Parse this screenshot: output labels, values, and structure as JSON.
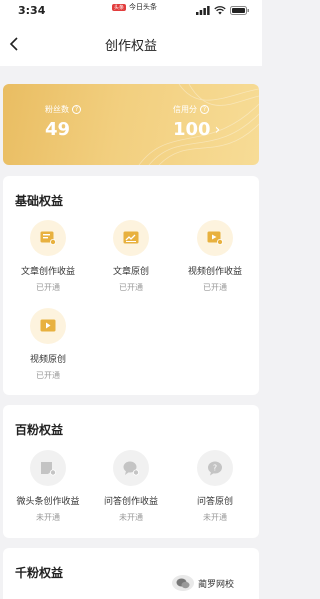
{
  "status_bar": {
    "time": "3:34",
    "app_badge": "头条",
    "app_name": "今日头条"
  },
  "nav": {
    "title": "创作权益",
    "back_icon": "chevron-left-icon"
  },
  "summary": {
    "fans_label": "粉丝数",
    "fans_value": "49",
    "credit_label": "信用分",
    "credit_value": "100"
  },
  "sections": [
    {
      "title": "基础权益",
      "items": [
        {
          "label": "文章创作收益",
          "status": "已开通",
          "icon": "article-income-icon"
        },
        {
          "label": "文章原创",
          "status": "已开通",
          "icon": "article-original-icon"
        },
        {
          "label": "视频创作收益",
          "status": "已开通",
          "icon": "video-income-icon"
        },
        {
          "label": "视频原创",
          "status": "已开通",
          "icon": "video-original-icon"
        }
      ]
    },
    {
      "title": "百粉权益",
      "items": [
        {
          "label": "微头条创作收益",
          "status": "未开通",
          "icon": "micro-post-income-icon"
        },
        {
          "label": "问答创作收益",
          "status": "未开通",
          "icon": "qa-income-icon"
        },
        {
          "label": "问答原创",
          "status": "未开通",
          "icon": "qa-original-icon"
        }
      ]
    },
    {
      "title": "千粉权益",
      "items": []
    }
  ],
  "watermark": {
    "text": "蔺罗网校"
  },
  "colors": {
    "accent_gold": "#e9bd62",
    "icon_gold": "#e8b13f",
    "icon_grey": "#c4c4c4"
  }
}
